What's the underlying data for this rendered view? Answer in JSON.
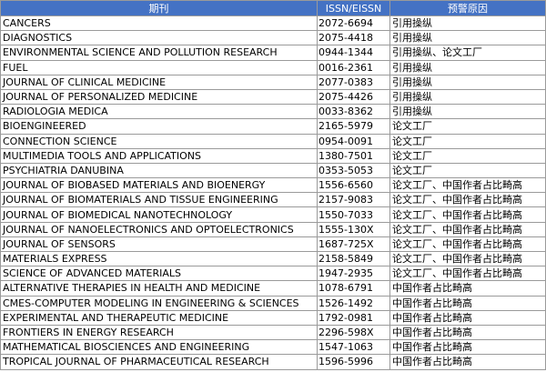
{
  "table": {
    "headers": [
      "期刊",
      "ISSN/EISSN",
      "预警原因"
    ],
    "rows": [
      [
        "CANCERS",
        "2072-6694",
        "引用操纵"
      ],
      [
        "DIAGNOSTICS",
        "2075-4418",
        "引用操纵"
      ],
      [
        "ENVIRONMENTAL SCIENCE AND POLLUTION RESEARCH",
        "0944-1344",
        "引用操纵、论文工厂"
      ],
      [
        "FUEL",
        "0016-2361",
        "引用操纵"
      ],
      [
        "JOURNAL OF CLINICAL MEDICINE",
        "2077-0383",
        "引用操纵"
      ],
      [
        "JOURNAL OF PERSONALIZED MEDICINE",
        "2075-4426",
        "引用操纵"
      ],
      [
        "RADIOLOGIA MEDICA",
        "0033-8362",
        "引用操纵"
      ],
      [
        "BIOENGINEERED",
        "2165-5979",
        "论文工厂"
      ],
      [
        "CONNECTION SCIENCE",
        "0954-0091",
        "论文工厂"
      ],
      [
        "MULTIMEDIA TOOLS AND APPLICATIONS",
        "1380-7501",
        "论文工厂"
      ],
      [
        "PSYCHIATRIA DANUBINA",
        "0353-5053",
        "论文工厂"
      ],
      [
        "JOURNAL OF BIOBASED MATERIALS AND BIOENERGY",
        "1556-6560",
        "论文工厂、中国作者占比畸高"
      ],
      [
        "JOURNAL OF BIOMATERIALS AND TISSUE ENGINEERING",
        "2157-9083",
        "论文工厂、中国作者占比畸高"
      ],
      [
        "JOURNAL OF BIOMEDICAL NANOTECHNOLOGY",
        "1550-7033",
        "论文工厂、中国作者占比畸高"
      ],
      [
        "JOURNAL OF NANOELECTRONICS AND OPTOELECTRONICS",
        "1555-130X",
        "论文工厂、中国作者占比畸高"
      ],
      [
        "JOURNAL OF SENSORS",
        "1687-725X",
        "论文工厂、中国作者占比畸高"
      ],
      [
        "MATERIALS EXPRESS",
        "2158-5849",
        "论文工厂、中国作者占比畸高"
      ],
      [
        "SCIENCE OF ADVANCED MATERIALS",
        "1947-2935",
        "论文工厂、中国作者占比畸高"
      ],
      [
        "ALTERNATIVE THERAPIES IN HEALTH AND MEDICINE",
        "1078-6791",
        "中国作者占比畸高"
      ],
      [
        "CMES-COMPUTER MODELING IN ENGINEERING & SCIENCES",
        "1526-1492",
        "中国作者占比畸高"
      ],
      [
        "EXPERIMENTAL AND THERAPEUTIC MEDICINE",
        "1792-0981",
        "中国作者占比畸高"
      ],
      [
        "FRONTIERS IN ENERGY RESEARCH",
        "2296-598X",
        "中国作者占比畸高"
      ],
      [
        "MATHEMATICAL BIOSCIENCES AND ENGINEERING",
        "1547-1063",
        "中国作者占比畸高"
      ],
      [
        "TROPICAL JOURNAL OF PHARMACEUTICAL RESEARCH",
        "1596-5996",
        "中国作者占比畸高"
      ]
    ]
  }
}
